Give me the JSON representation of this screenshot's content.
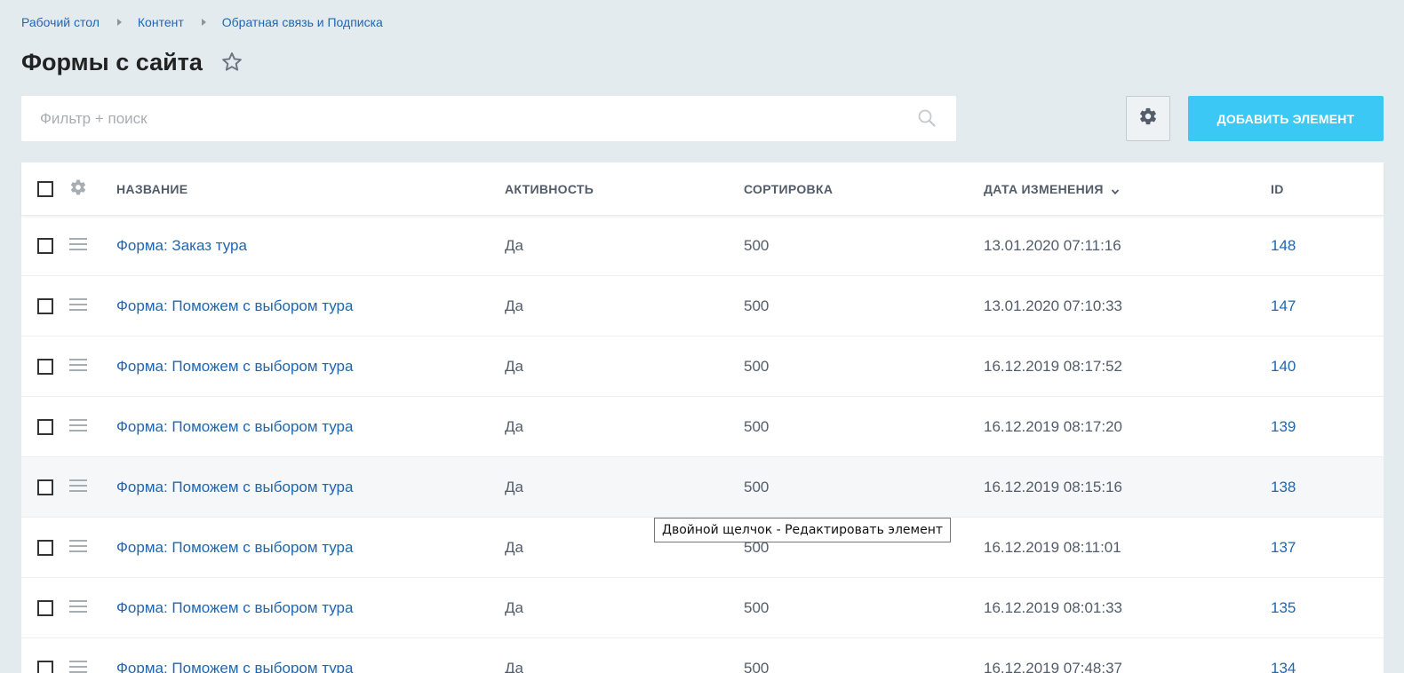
{
  "breadcrumb": [
    "Рабочий стол",
    "Контент",
    "Обратная связь и Подписка"
  ],
  "page_title": "Формы с сайта",
  "filter": {
    "placeholder": "Фильтр + поиск"
  },
  "toolbar": {
    "add_label": "ДОБАВИТЬ ЭЛЕМЕНТ"
  },
  "icons": {
    "star": "star-icon",
    "search": "search-icon",
    "settings": "gear-icon",
    "drag": "drag-handle-icon",
    "sort": "chevron-down-icon"
  },
  "colors": {
    "accent": "#3bc8f5",
    "link": "#2067b0",
    "background": "#e4ebee"
  },
  "table": {
    "columns": [
      "НАЗВАНИЕ",
      "АКТИВНОСТЬ",
      "СОРТИРОВКА",
      "ДАТА ИЗМЕНЕНИЯ",
      "ID"
    ],
    "sorted_column": "ДАТА ИЗМЕНЕНИЯ",
    "rows": [
      {
        "name": "Форма: Заказ тура",
        "active": "Да",
        "sort": "500",
        "date": "13.01.2020 07:11:16",
        "id": "148"
      },
      {
        "name": "Форма: Поможем с выбором тура",
        "active": "Да",
        "sort": "500",
        "date": "13.01.2020 07:10:33",
        "id": "147"
      },
      {
        "name": "Форма: Поможем с выбором тура",
        "active": "Да",
        "sort": "500",
        "date": "16.12.2019 08:17:52",
        "id": "140"
      },
      {
        "name": "Форма: Поможем с выбором тура",
        "active": "Да",
        "sort": "500",
        "date": "16.12.2019 08:17:20",
        "id": "139"
      },
      {
        "name": "Форма: Поможем с выбором тура",
        "active": "Да",
        "sort": "500",
        "date": "16.12.2019 08:15:16",
        "id": "138"
      },
      {
        "name": "Форма: Поможем с выбором тура",
        "active": "Да",
        "sort": "500",
        "date": "16.12.2019 08:11:01",
        "id": "137"
      },
      {
        "name": "Форма: Поможем с выбором тура",
        "active": "Да",
        "sort": "500",
        "date": "16.12.2019 08:01:33",
        "id": "135"
      },
      {
        "name": "Форма: Поможем с выбором тура",
        "active": "Да",
        "sort": "500",
        "date": "16.12.2019 07:48:37",
        "id": "134"
      }
    ]
  },
  "tooltip": "Двойной щелчок - Редактировать элемент"
}
